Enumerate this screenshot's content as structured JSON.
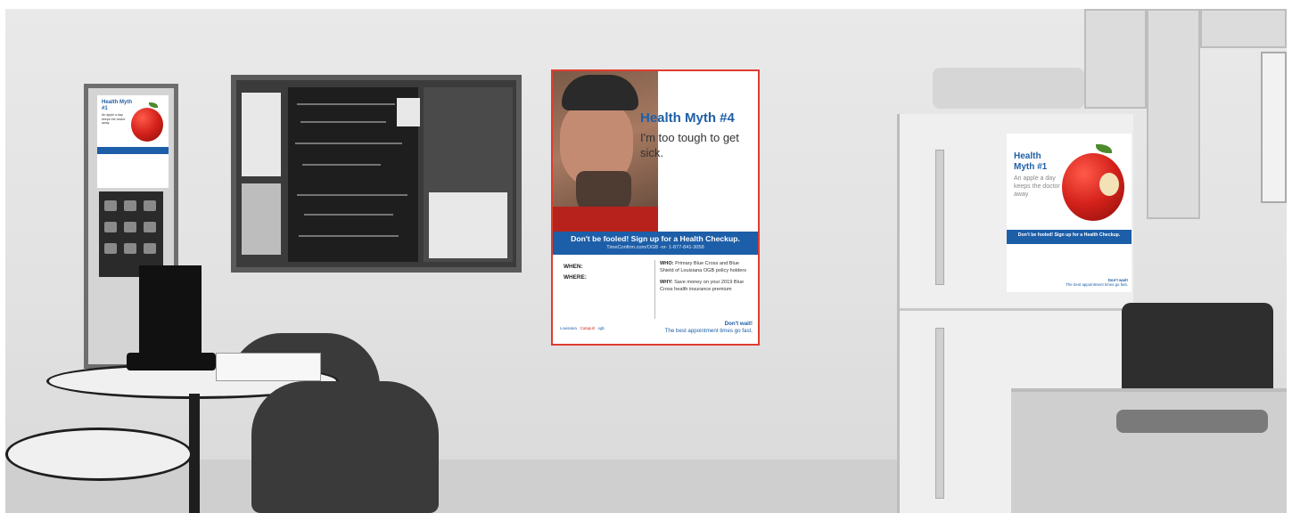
{
  "main_poster": {
    "title": "Health Myth #4",
    "subtitle": "I'm too tough to get sick.",
    "banner": "Don't be fooled! Sign up for a Health Checkup.",
    "banner_sub": "TimeConfirm.com/OGB  -or-  1-877-841-3058",
    "when_label": "WHEN:",
    "where_label": "WHERE:",
    "who_label": "WHO:",
    "who_text": "Primary Blue Cross and Blue Shield of Louisiana OGB policy holders",
    "why_label": "WHY:",
    "why_text": "Save money on your 2019 Blue Cross health insurance premium",
    "cta_bold": "Don't wait!",
    "cta_text": "The best appointment times go fast.",
    "logos": [
      "Louisiana",
      "Catapult",
      "ogb"
    ]
  },
  "fridge_poster": {
    "title": "Health Myth #1",
    "subtitle": "An apple a day keeps the doctor away",
    "banner": "Don't be fooled! Sign up for a Health Checkup.",
    "cta_bold": "Don't wait!",
    "cta_text": "The best appointment times go fast."
  },
  "door_poster": {
    "title": "Health Myth #1",
    "subtitle": "An apple a day keeps the doctor away"
  },
  "colors": {
    "poster_blue": "#1d5ea8",
    "poster_border": "#e03c2e",
    "apple_red": "#d3211a"
  }
}
